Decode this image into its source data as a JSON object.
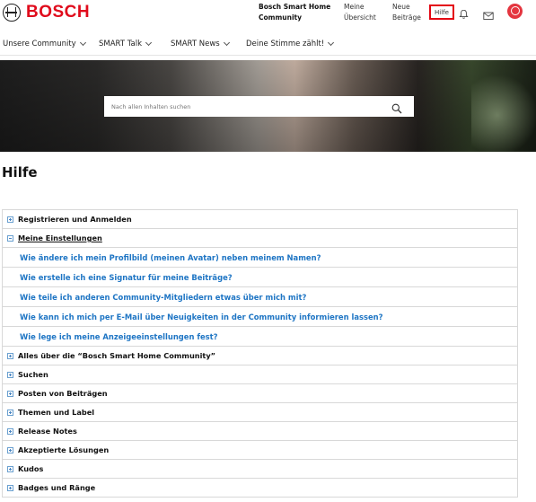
{
  "header": {
    "logo_text": "BOSCH",
    "community_title_line1": "Bosch Smart Home",
    "community_title_line2": "Community",
    "link_overview_line1": "Meine",
    "link_overview_line2": "Übersicht",
    "link_new_line1": "Neue",
    "link_new_line2": "Beiträge",
    "help_label": "Hilfe",
    "accent_color": "#e30613"
  },
  "nav": {
    "items": [
      {
        "label": "Unsere Community"
      },
      {
        "label": "SMART Talk"
      },
      {
        "label": "SMART News"
      },
      {
        "label": "Deine Stimme zählt!"
      }
    ]
  },
  "search": {
    "placeholder": "Nach allen Inhalten suchen"
  },
  "page": {
    "title": "Hilfe"
  },
  "accordion": {
    "sections": [
      {
        "label": "Registrieren und Anmelden",
        "expanded": false
      },
      {
        "label": "Meine Einstellungen",
        "expanded": true
      },
      {
        "label": "Alles über die “Bosch Smart Home Community”",
        "expanded": false
      },
      {
        "label": "Suchen",
        "expanded": false
      },
      {
        "label": "Posten von Beiträgen",
        "expanded": false
      },
      {
        "label": "Themen und Label",
        "expanded": false
      },
      {
        "label": "Release Notes",
        "expanded": false
      },
      {
        "label": "Akzeptierte Lösungen",
        "expanded": false
      },
      {
        "label": "Kudos",
        "expanded": false
      },
      {
        "label": "Badges und Ränge",
        "expanded": false
      }
    ],
    "settings_links": [
      {
        "label": "Wie ändere ich mein Profilbild (meinen Avatar) neben meinem Namen?"
      },
      {
        "label": "Wie erstelle ich eine Signatur für meine Beiträge?"
      },
      {
        "label": "Wie teile ich anderen Community-Mitgliedern etwas über mich mit?"
      },
      {
        "label": "Wie kann ich mich per E-Mail über Neuigkeiten in der Community informieren lassen?"
      },
      {
        "label": "Wie lege ich meine Anzeigeeinstellungen fest?"
      }
    ],
    "link_color": "#1e75c4"
  }
}
